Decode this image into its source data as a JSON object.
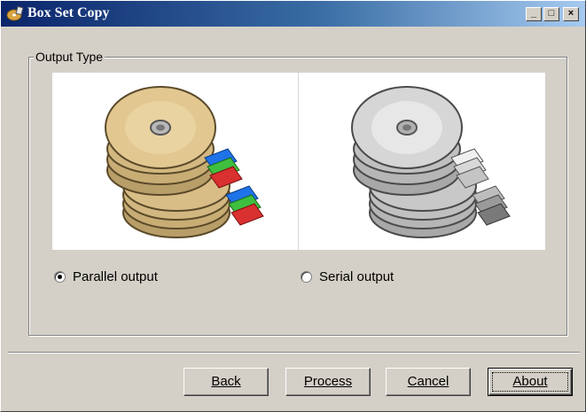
{
  "window": {
    "title": "Box Set Copy"
  },
  "titlebar_buttons": {
    "minimize": "_",
    "maximize": "□",
    "close": "×"
  },
  "group": {
    "legend": "Output Type"
  },
  "options": {
    "parallel": {
      "label": "Parallel output",
      "selected": true
    },
    "serial": {
      "label": "Serial output",
      "selected": false
    }
  },
  "buttons": {
    "back": "Back",
    "process": "Process",
    "cancel": "Cancel",
    "about": "About"
  },
  "colors": {
    "titlebar_start": "#0a246a",
    "titlebar_end": "#a6caf0",
    "face": "#d4d0c8",
    "disc_gold": "#d9bd86",
    "disc_gray": "#c8c8c8"
  },
  "icons": {
    "app": "disc-app-icon",
    "parallel_image": "gold-disc-stack-with-colored-folders",
    "serial_image": "gray-disc-stack-with-gray-folders"
  }
}
